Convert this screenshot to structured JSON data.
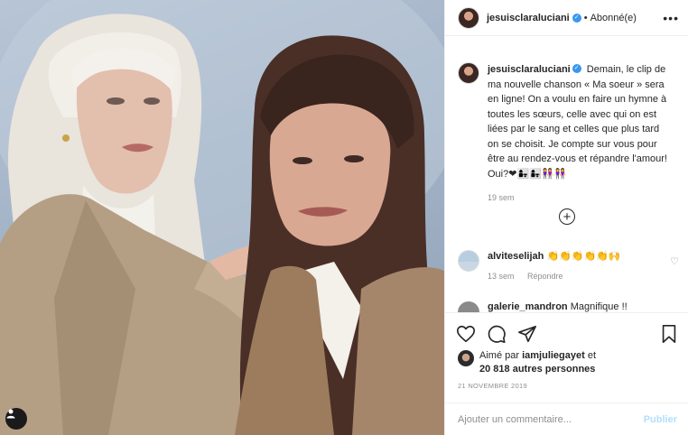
{
  "post": {
    "username": "jesuisclaraluciani",
    "verified_symbol": "✓",
    "separator": "•",
    "follow_status": "Abonné(e)",
    "more_symbol": "•••"
  },
  "caption": {
    "username": "jesuisclaraluciani",
    "text": "Demain, le clip de ma nouvelle chanson « Ma soeur » sera en ligne! On a voulu en faire un hymne à toutes les sœurs, celle avec qui on est liées par le sang et celles que plus tard on se choisit. Je compte sur vous pour être au rendez-vous et répandre l'amour! Oui?❤👩‍👧👩‍👧👭👭",
    "time": "19 sem"
  },
  "load_more_symbol": "+",
  "comments": [
    {
      "username": "alviteselijah",
      "text": "👏👏👏👏👏🙌",
      "time": "13 sem",
      "reply_label": "Répondre"
    },
    {
      "username": "galerie_mandron",
      "text": "Magnifique !!"
    }
  ],
  "likes": {
    "prefix": "Aimé par",
    "user": "iamjuliegayet",
    "connector": "et",
    "count_text": "20 818 autres personnes"
  },
  "date": "21 NOVEMBRE 2019",
  "add_comment": {
    "placeholder": "Ajouter un commentaire...",
    "post_label": "Publier"
  },
  "colors": {
    "accent_blue": "#3897f0",
    "publish_disabled": "#b2dffc",
    "muted_text": "#8e8e8e"
  },
  "icons": [
    "heart-icon",
    "comment-icon",
    "share-icon",
    "bookmark-icon",
    "more-icon",
    "verified-badge-icon",
    "plus-circle-icon",
    "user-tag-icon"
  ]
}
